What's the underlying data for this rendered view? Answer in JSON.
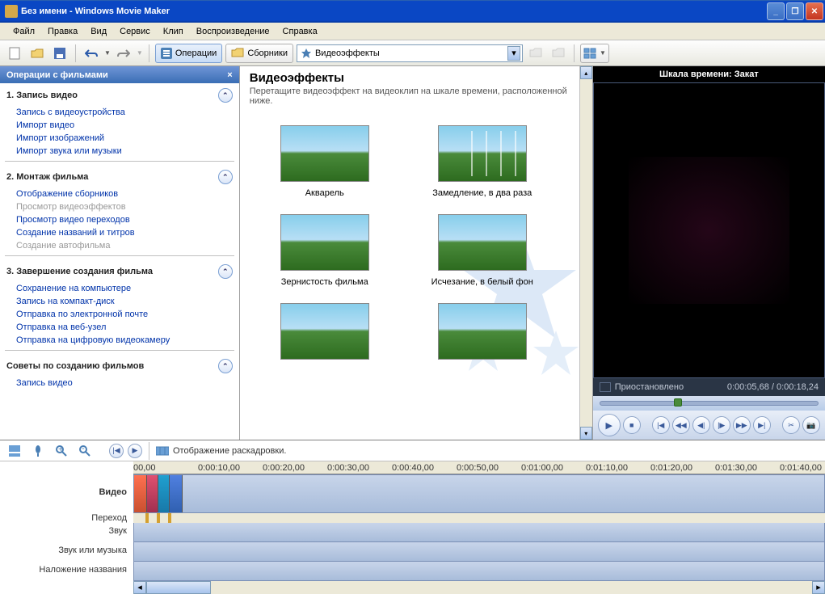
{
  "window": {
    "title": "Без имени - Windows Movie Maker"
  },
  "menu": [
    "Файл",
    "Правка",
    "Вид",
    "Сервис",
    "Клип",
    "Воспроизведение",
    "Справка"
  ],
  "toolbar": {
    "operations": "Операции",
    "collections": "Сборники",
    "combo_value": "Видеоэффекты"
  },
  "tasks": {
    "header": "Операции с фильмами",
    "sections": [
      {
        "title": "1. Запись видео",
        "links": [
          {
            "t": "Запись с видеоустройства",
            "d": false
          },
          {
            "t": "Импорт видео",
            "d": false
          },
          {
            "t": "Импорт изображений",
            "d": false
          },
          {
            "t": "Импорт звука или музыки",
            "d": false
          }
        ]
      },
      {
        "title": "2. Монтаж фильма",
        "links": [
          {
            "t": "Отображение сборников",
            "d": false
          },
          {
            "t": "Просмотр видеоэффектов",
            "d": true
          },
          {
            "t": "Просмотр видео переходов",
            "d": false
          },
          {
            "t": "Создание названий и титров",
            "d": false
          },
          {
            "t": "Создание автофильма",
            "d": true
          }
        ]
      },
      {
        "title": "3. Завершение создания фильма",
        "links": [
          {
            "t": "Сохранение на компьютере",
            "d": false
          },
          {
            "t": "Запись на компакт-диск",
            "d": false
          },
          {
            "t": "Отправка по электронной почте",
            "d": false
          },
          {
            "t": "Отправка на веб-узел",
            "d": false
          },
          {
            "t": "Отправка на цифровую видеокамеру",
            "d": false
          }
        ]
      },
      {
        "title": "Советы по созданию фильмов",
        "links": [
          {
            "t": "Запись видео",
            "d": false
          }
        ]
      }
    ]
  },
  "content": {
    "title": "Видеоэффекты",
    "subtitle": "Перетащите видеоэффект на видеоклип на шкале времени, расположенной ниже.",
    "effects": [
      "Акварель",
      "Замедление, в два раза",
      "Зернистость фильма",
      "Исчезание, в белый фон",
      "",
      ""
    ]
  },
  "preview": {
    "title": "Шкала времени: Закат",
    "status": "Приостановлено",
    "time_current": "0:00:05,68",
    "time_total": "0:00:18,24"
  },
  "timeline": {
    "storyboard_label": "Отображение раскадровки.",
    "tracks": [
      "Видео",
      "Переход",
      "Звук",
      "Звук или музыка",
      "Наложение названия"
    ],
    "ruler": [
      "00,00",
      "0:00:10,00",
      "0:00:20,00",
      "0:00:30,00",
      "0:00:40,00",
      "0:00:50,00",
      "0:01:00,00",
      "0:01:10,00",
      "0:01:20,00",
      "0:01:30,00",
      "0:01:40,00"
    ]
  }
}
